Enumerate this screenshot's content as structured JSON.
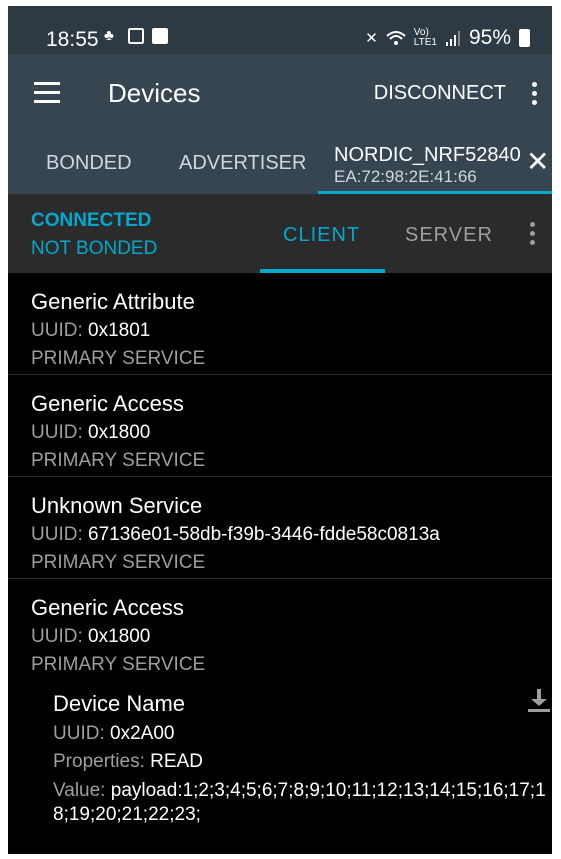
{
  "status_bar": {
    "time": "18:55",
    "battery": "95%",
    "left_icons": [
      "notification-icon",
      "square-icon",
      "image-icon"
    ],
    "right_icons": [
      "mute-icon",
      "wifi-icon",
      "volte-icon",
      "signal-icon",
      "battery-icon"
    ]
  },
  "appbar": {
    "title": "Devices",
    "disconnect_label": "DISCONNECT",
    "tabs": {
      "bonded": "BONDED",
      "advertiser": "ADVERTISER",
      "device_name": "NORDIC_NRF52840",
      "device_mac": "EA:72:98:2E:41:66"
    },
    "accent": "#00a9ce",
    "background": "#36454f"
  },
  "connection": {
    "state": "CONNECTED",
    "bond": "NOT BONDED",
    "tab_client": "CLIENT",
    "tab_server": "SERVER"
  },
  "services": [
    {
      "name": "Generic Attribute",
      "uuid_label": "UUID:",
      "uuid": "0x1801",
      "type": "PRIMARY SERVICE"
    },
    {
      "name": "Generic Access",
      "uuid_label": "UUID:",
      "uuid": "0x1800",
      "type": "PRIMARY SERVICE"
    },
    {
      "name": "Unknown Service",
      "uuid_label": "UUID:",
      "uuid": "67136e01-58db-f39b-3446-fdde58c0813a",
      "type": "PRIMARY SERVICE"
    },
    {
      "name": "Generic Access",
      "uuid_label": "UUID:",
      "uuid": "0x1800",
      "type": "PRIMARY SERVICE",
      "characteristic": {
        "name": "Device Name",
        "uuid_label": "UUID:",
        "uuid": "0x2A00",
        "properties_label": "Properties:",
        "properties": "READ",
        "value_label": "Value:",
        "value": "payload:1;2;3;4;5;6;7;8;9;10;11;12;13;14;15;16;17;18;19;20;21;22;23;"
      }
    }
  ]
}
